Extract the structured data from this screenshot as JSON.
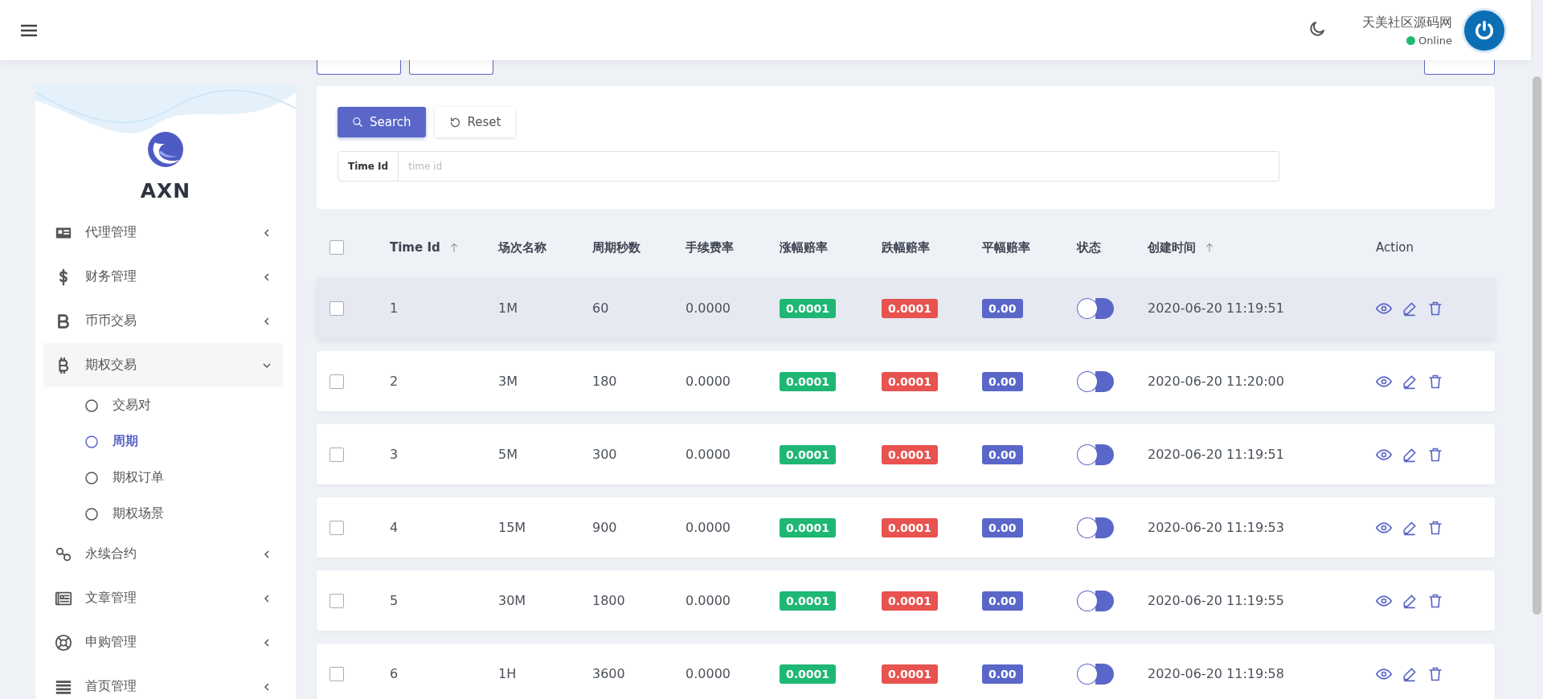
{
  "header": {
    "user_name": "天美社区源码网",
    "status": "Online"
  },
  "sidebar": {
    "brand": "AXN",
    "items": [
      {
        "label": "代理管理",
        "expanded": false
      },
      {
        "label": "财务管理",
        "expanded": false
      },
      {
        "label": "币币交易",
        "expanded": false
      },
      {
        "label": "期权交易",
        "expanded": true,
        "children": [
          {
            "label": "交易对",
            "selected": false
          },
          {
            "label": "周期",
            "selected": true
          },
          {
            "label": "期权订单",
            "selected": false
          },
          {
            "label": "期权场景",
            "selected": false
          }
        ]
      },
      {
        "label": "永续合约",
        "expanded": false
      },
      {
        "label": "文章管理",
        "expanded": false
      },
      {
        "label": "申购管理",
        "expanded": false
      },
      {
        "label": "首页管理",
        "expanded": false
      }
    ]
  },
  "filter": {
    "search_button": "Search",
    "reset_button": "Reset",
    "field_label": "Time Id",
    "placeholder": "time id"
  },
  "table": {
    "all_checked": false,
    "columns": [
      {
        "label": "Time Id",
        "sortable": true
      },
      {
        "label": "场次名称",
        "sortable": false
      },
      {
        "label": "周期秒数",
        "sortable": false
      },
      {
        "label": "手续费率",
        "sortable": false
      },
      {
        "label": "涨幅赔率",
        "sortable": false
      },
      {
        "label": "跌幅赔率",
        "sortable": false
      },
      {
        "label": "平幅赔率",
        "sortable": false
      },
      {
        "label": "状态",
        "sortable": false
      },
      {
        "label": "创建时间",
        "sortable": true
      },
      {
        "label": "Action",
        "sortable": false
      }
    ],
    "rows": [
      {
        "checked": false,
        "highlighted": true,
        "time_id": "1",
        "name": "1M",
        "seconds": "60",
        "fee_rate": "0.0000",
        "up_odds": "0.0001",
        "down_odds": "0.0001",
        "flat_odds": "0.00",
        "status_on": false,
        "created_at": "2020-06-20 11:19:51"
      },
      {
        "checked": false,
        "highlighted": false,
        "time_id": "2",
        "name": "3M",
        "seconds": "180",
        "fee_rate": "0.0000",
        "up_odds": "0.0001",
        "down_odds": "0.0001",
        "flat_odds": "0.00",
        "status_on": false,
        "created_at": "2020-06-20 11:20:00"
      },
      {
        "checked": false,
        "highlighted": false,
        "time_id": "3",
        "name": "5M",
        "seconds": "300",
        "fee_rate": "0.0000",
        "up_odds": "0.0001",
        "down_odds": "0.0001",
        "flat_odds": "0.00",
        "status_on": false,
        "created_at": "2020-06-20 11:19:51"
      },
      {
        "checked": false,
        "highlighted": false,
        "time_id": "4",
        "name": "15M",
        "seconds": "900",
        "fee_rate": "0.0000",
        "up_odds": "0.0001",
        "down_odds": "0.0001",
        "flat_odds": "0.00",
        "status_on": false,
        "created_at": "2020-06-20 11:19:53"
      },
      {
        "checked": false,
        "highlighted": false,
        "time_id": "5",
        "name": "30M",
        "seconds": "1800",
        "fee_rate": "0.0000",
        "up_odds": "0.0001",
        "down_odds": "0.0001",
        "flat_odds": "0.00",
        "status_on": false,
        "created_at": "2020-06-20 11:19:55"
      },
      {
        "checked": false,
        "highlighted": false,
        "time_id": "6",
        "name": "1H",
        "seconds": "3600",
        "fee_rate": "0.0000",
        "up_odds": "0.0001",
        "down_odds": "0.0001",
        "flat_odds": "0.00",
        "status_on": false,
        "created_at": "2020-06-20 11:19:58"
      }
    ]
  }
}
